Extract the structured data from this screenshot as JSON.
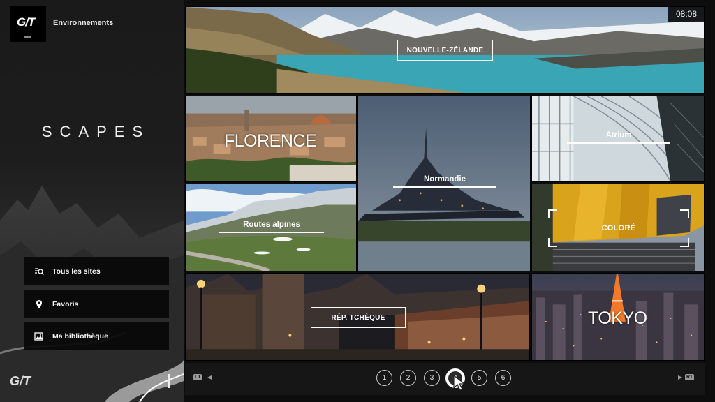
{
  "app": {
    "logo_icon": "gt-logo-icon",
    "section_label": "Environnements",
    "title": "SCAPES"
  },
  "clock": "08:08",
  "sidebar": {
    "items": [
      {
        "label": "Tous les sites",
        "icon": "search-list-icon"
      },
      {
        "label": "Favoris",
        "icon": "location-pin-icon"
      },
      {
        "label": "Ma bibliothèque",
        "icon": "photo-library-icon"
      }
    ]
  },
  "tiles": {
    "new_zealand": "NOUVELLE-ZÉLANDE",
    "florence": "FLORENCE",
    "normandie": "Normandie",
    "atrium": "Atrium",
    "routes_alpines": "Routes alpines",
    "colore": "COLORÉ",
    "rep_tcheque": "RÉP. TCHÈQUE",
    "tokyo": "TOKYO"
  },
  "pager": {
    "prev_button": "L1",
    "next_button": "R1",
    "pages": [
      "1",
      "2",
      "3",
      "4",
      "5",
      "6"
    ],
    "current_page": "4"
  },
  "colors": {
    "lake": "#3aa6b5",
    "golden": "#d9a31c",
    "sidebar_button": "#080808"
  }
}
